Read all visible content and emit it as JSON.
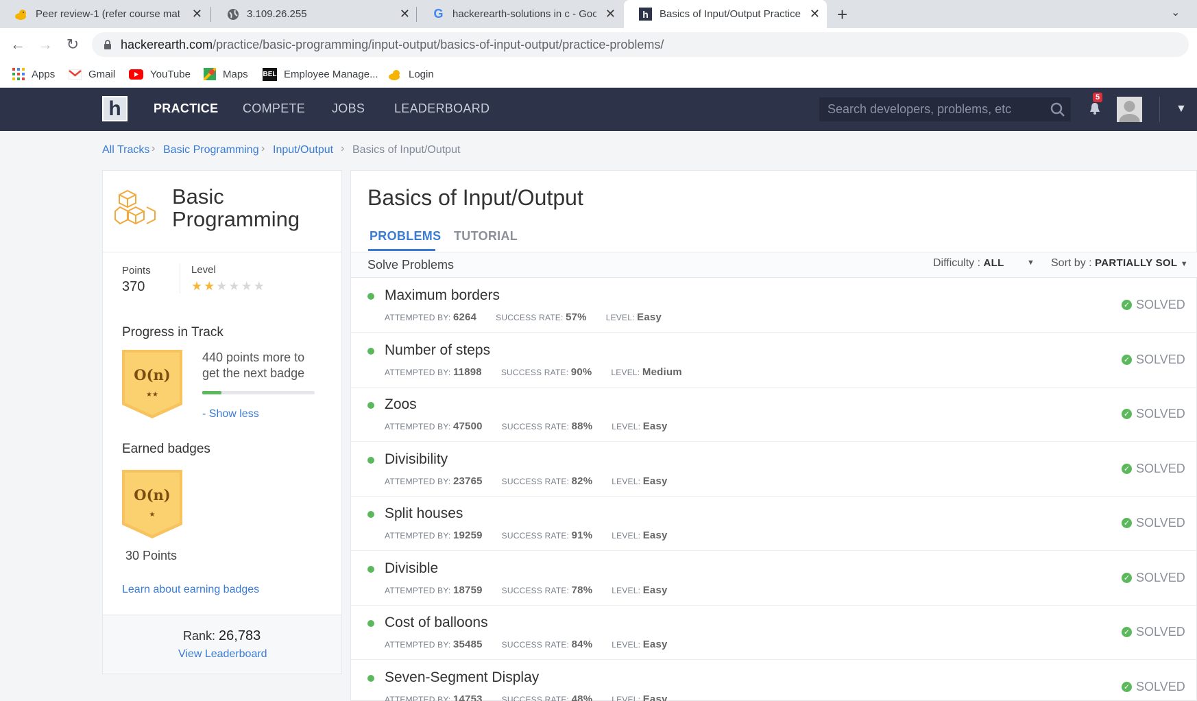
{
  "browser": {
    "tabs": [
      {
        "title": "Peer review-1 (refer course mater",
        "favicon": "duck-icon",
        "active": false
      },
      {
        "title": "3.109.26.255",
        "favicon": "globe-icon",
        "active": false
      },
      {
        "title": "hackerearth-solutions in c - Goog",
        "favicon": "google-icon",
        "active": false
      },
      {
        "title": "Basics of Input/Output Practice P",
        "favicon": "hackerearth-icon",
        "active": true
      }
    ],
    "url_host": "hackerearth.com",
    "url_path": "/practice/basic-programming/input-output/basics-of-input-output/practice-problems/",
    "bookmarks": [
      {
        "label": "Apps",
        "icon": "apps-grid-icon"
      },
      {
        "label": "Gmail",
        "icon": "gmail-icon"
      },
      {
        "label": "YouTube",
        "icon": "youtube-icon"
      },
      {
        "label": "Maps",
        "icon": "maps-icon"
      },
      {
        "label": "Employee Manage...",
        "icon": "bel-icon"
      },
      {
        "label": "Login",
        "icon": "duck-icon"
      }
    ]
  },
  "nav": {
    "logo": "h",
    "items": [
      "PRACTICE",
      "COMPETE",
      "JOBS",
      "LEADERBOARD"
    ],
    "active": "PRACTICE",
    "search_placeholder": "Search developers, problems, etc",
    "notifications": "5"
  },
  "breadcrumb": [
    "All Tracks",
    "Basic Programming",
    "Input/Output",
    "Basics of Input/Output"
  ],
  "track": {
    "name_line1": "Basic",
    "name_line2": "Programming",
    "points_label": "Points",
    "points": "370",
    "level_label": "Level",
    "level_stars": 2,
    "level_max": 6,
    "progress_heading": "Progress in Track",
    "badge_text": "O(n)",
    "next_badge_stars": "★★",
    "points_more": "440 points more to get the next badge",
    "progress_fraction": 0.17,
    "show_less": "- Show less",
    "earned_heading": "Earned badges",
    "earned_badge_stars": "★",
    "earned_points": "30 Points",
    "learn_link": "Learn about earning badges",
    "rank_label": "Rank:",
    "rank": "26,783",
    "leaderboard_link": "View Leaderboard"
  },
  "main": {
    "title": "Basics of Input/Output",
    "tabs": [
      "PROBLEMS",
      "TUTORIAL"
    ],
    "solve_label": "Solve Problems",
    "difficulty_label": "Difficulty :",
    "difficulty_value": "ALL",
    "sort_label": "Sort by :",
    "sort_value": "PARTIALLY SOL",
    "attempted_label": "ATTEMPTED BY:",
    "success_label": "SUCCESS RATE:",
    "level_label": "LEVEL:",
    "status_label": "SOLVED",
    "problems": [
      {
        "name": "Maximum borders",
        "attempted": "6264",
        "success": "57%",
        "level": "Easy"
      },
      {
        "name": "Number of steps",
        "attempted": "11898",
        "success": "90%",
        "level": "Medium"
      },
      {
        "name": "Zoos",
        "attempted": "47500",
        "success": "88%",
        "level": "Easy"
      },
      {
        "name": "Divisibility",
        "attempted": "23765",
        "success": "82%",
        "level": "Easy"
      },
      {
        "name": "Split houses",
        "attempted": "19259",
        "success": "91%",
        "level": "Easy"
      },
      {
        "name": "Divisible",
        "attempted": "18759",
        "success": "78%",
        "level": "Easy"
      },
      {
        "name": "Cost of balloons",
        "attempted": "35485",
        "success": "84%",
        "level": "Easy"
      },
      {
        "name": "Seven-Segment Display",
        "attempted": "14753",
        "success": "48%",
        "level": "Easy"
      }
    ]
  },
  "colors": {
    "nav_bg": "#2d3348",
    "link": "#3a7bd5",
    "success": "#5cb85c",
    "badge": "#f7c35f"
  }
}
